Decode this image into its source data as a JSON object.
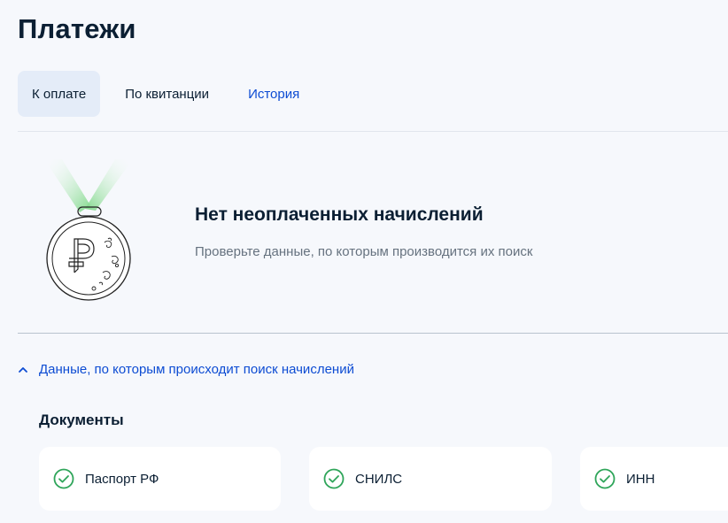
{
  "header": {
    "title": "Платежи"
  },
  "tabs": [
    {
      "label": "К оплате",
      "active": true
    },
    {
      "label": "По квитанции",
      "active": false
    },
    {
      "label": "История",
      "active": false
    }
  ],
  "empty_state": {
    "illustration": "ruble-medal-icon",
    "title": "Нет неоплаченных начислений",
    "subtitle": "Проверьте данные, по которым производится их поиск"
  },
  "search_data": {
    "expander_label": "Данные, по которым происходит поиск начислений",
    "expanded": true,
    "documents_title": "Документы",
    "documents": [
      {
        "label": "Паспорт РФ",
        "icon": "check-circle-icon",
        "verified": true
      },
      {
        "label": "СНИЛС",
        "icon": "check-circle-icon",
        "verified": true
      },
      {
        "label": "ИНН",
        "icon": "check-circle-icon",
        "verified": true
      }
    ]
  },
  "colors": {
    "background": "#f6f8fc",
    "accent_link": "#0d4cd3",
    "active_tab_bg": "#e4ecf8",
    "check_green": "#2fa55a",
    "text_primary": "#0b1f33",
    "text_secondary": "#66727f"
  }
}
